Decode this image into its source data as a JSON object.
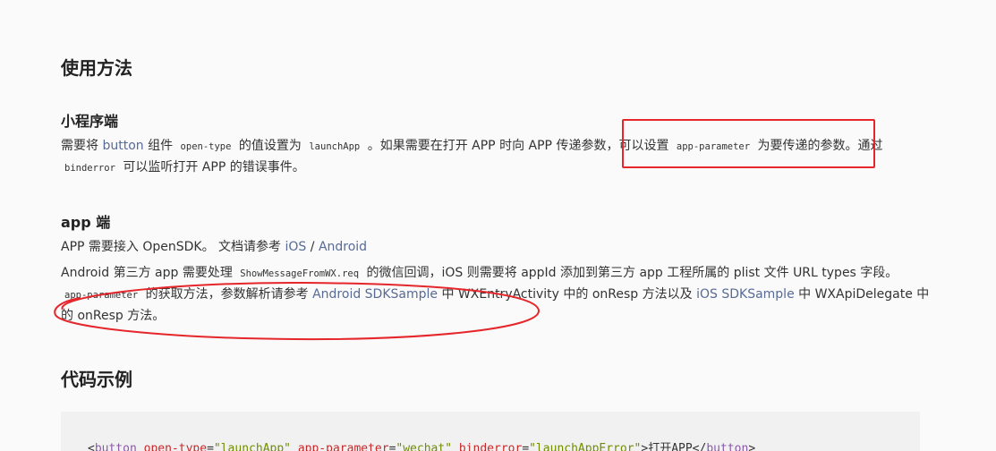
{
  "section_usage": {
    "title": "使用方法"
  },
  "miniprogram": {
    "title": "小程序端",
    "p1_a": "需要将 ",
    "p1_link_button": "button",
    "p1_b": " 组件 ",
    "p1_code_opentype": "open-type",
    "p1_c": " 的值设置为 ",
    "p1_code_launchapp": "launchApp",
    "p1_d": " 。如果需要在打开 APP 时向 APP 传递参数，可以设置 ",
    "p1_code_param": "app-parameter",
    "p1_e": " 为要传递的参数。通过",
    "p2_code_binderror": "binderror",
    "p2_a": " 可以监听打开 APP 的错误事件。"
  },
  "app": {
    "title": "app 端",
    "p1_a": "APP 需要接入 OpenSDK。 文档请参考 ",
    "p1_link_ios": "iOS",
    "p1_sep": " / ",
    "p1_link_android": "Android",
    "p2_a": "Android 第三方 app 需要处理 ",
    "p2_code_show": "ShowMessageFromWX.req",
    "p2_b": " 的微信回调，iOS 则需要将 appId 添加到第三方 app 工程所属的 plist 文件 URL types 字段。",
    "p3_code_param": "app-parameter",
    "p3_a": " 的获取方法，参数解析请参考 ",
    "p3_link_android_sample": "Android SDKSample",
    "p3_b": " 中 WXEntryActivity 中的 onResp 方法以及 ",
    "p3_link_ios_sample": "iOS SDKSample",
    "p3_c": " 中 WXApiDelegate 中",
    "p4_a": "的 onResp 方法。"
  },
  "section_code": {
    "title": "代码示例"
  },
  "code": {
    "lt": "<",
    "tag_open": "button",
    "attr1": "open-type",
    "eq1": "=",
    "val1": "\"launchApp\"",
    "attr2": "app-parameter",
    "eq2": "=",
    "val2": "\"wechat\"",
    "attr3": "binderror",
    "eq3": "=",
    "val3": "\"launchAppError\"",
    "gt_text": ">打开APP</",
    "tag_close": "button",
    "gt": ">"
  },
  "colors": {
    "link": "#576b95",
    "annotation": "#e5262b"
  }
}
